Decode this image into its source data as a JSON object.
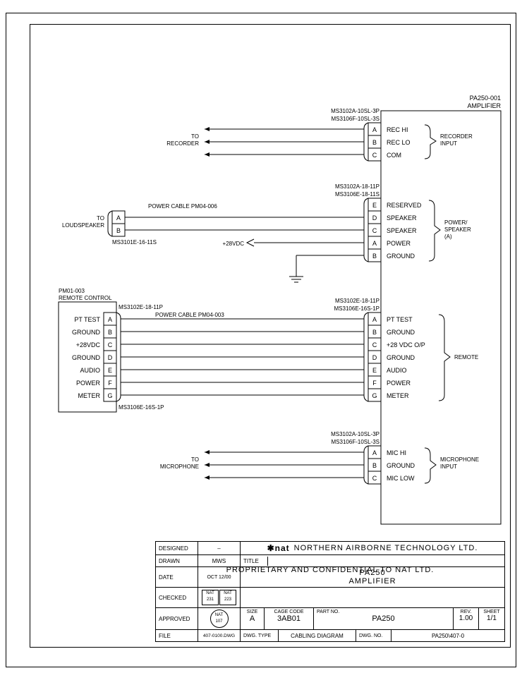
{
  "amplifier": {
    "title_top": "PA250-001",
    "title_sub": "AMPLIFIER",
    "connectors": {
      "recorder": {
        "top_part": "MS3102A-10SL-3P",
        "bottom_part": "MS3106F-10SL-3S",
        "pins": [
          {
            "pin": "A",
            "label": "REC HI"
          },
          {
            "pin": "B",
            "label": "REC LO"
          },
          {
            "pin": "C",
            "label": "COM"
          }
        ],
        "group": "RECORDER\nINPUT",
        "dest": "TO\nRECORDER"
      },
      "power_speaker": {
        "top_part": "MS3102A-18-11P",
        "bottom_part": "MS3106E-18-11S",
        "pins": [
          {
            "pin": "E",
            "label": "RESERVED"
          },
          {
            "pin": "D",
            "label": "SPEAKER"
          },
          {
            "pin": "C",
            "label": "SPEAKER"
          },
          {
            "pin": "A",
            "label": "POWER"
          },
          {
            "pin": "B",
            "label": "GROUND"
          }
        ],
        "group": "POWER/\nSPEAKER\n(A)",
        "cable": "POWER CABLE PM04-006",
        "v28": "+28VDC",
        "dest": "TO\nLOUDSPEAKER",
        "dest_conn": {
          "pins": [
            "A",
            "B"
          ],
          "part": "MS3101E-16-11S"
        }
      },
      "remote": {
        "top_part": "MS3102E-18-11P",
        "bottom_part": "MS3106E-16S-1P",
        "pins": [
          {
            "pin": "A",
            "label": "PT TEST"
          },
          {
            "pin": "B",
            "label": "GROUND"
          },
          {
            "pin": "C",
            "label": "+28 VDC O/P"
          },
          {
            "pin": "D",
            "label": "GROUND"
          },
          {
            "pin": "E",
            "label": "AUDIO"
          },
          {
            "pin": "F",
            "label": "POWER"
          },
          {
            "pin": "G",
            "label": "METER"
          }
        ],
        "group": "REMOTE",
        "cable": "POWER CABLE PM04-003"
      },
      "microphone": {
        "top_part": "MS3102A-10SL-3P",
        "bottom_part": "MS3106F-10SL-3S",
        "pins": [
          {
            "pin": "A",
            "label": "MIC HI"
          },
          {
            "pin": "B",
            "label": "GROUND"
          },
          {
            "pin": "C",
            "label": "MIC LOW"
          }
        ],
        "group": "MICROPHONE\nINPUT",
        "dest": "TO\nMICROPHONE"
      }
    }
  },
  "remote_control": {
    "title_top": "PM01-003",
    "title_sub": "REMOTE CONTROL",
    "top_part": "MS3102E-18-11P",
    "bottom_part": "MS3106E-16S-1P",
    "pins": [
      {
        "pin": "A",
        "label": "PT TEST"
      },
      {
        "pin": "B",
        "label": "GROUND"
      },
      {
        "pin": "C",
        "label": "+28VDC"
      },
      {
        "pin": "D",
        "label": "GROUND"
      },
      {
        "pin": "E",
        "label": "AUDIO"
      },
      {
        "pin": "F",
        "label": "POWER"
      },
      {
        "pin": "G",
        "label": "METER"
      }
    ]
  },
  "titleblock": {
    "proprietary": "PROPRIETARY AND CONFIDENTIAL TO NAT LTD.",
    "company_logo": "✱nat",
    "company": "NORTHERN AIRBORNE TECHNOLOGY LTD.",
    "designed_lbl": "DESIGNED",
    "designed": "–",
    "drawn_lbl": "DRAWN",
    "drawn": "MWS",
    "date_lbl": "DATE",
    "date": "OCT 12/00",
    "checked_lbl": "CHECKED",
    "checked_stamp1": "NAT\n231",
    "checked_stamp2": "NAT\n223",
    "approved_lbl": "APPROVED",
    "approved_stamp": "NAT\n107",
    "file_lbl": "FILE",
    "file": "407-0100.DWG",
    "title_lbl": "TITLE",
    "title1": "PA250",
    "title2": "AMPLIFIER",
    "size_lbl": "SIZE",
    "size": "A",
    "cage_lbl": "CAGE CODE",
    "cage": "3AB01",
    "part_lbl": "PART NO.",
    "part": "PA250",
    "rev_lbl": "REV.",
    "rev": "1.00",
    "sheet_lbl": "SHEET",
    "sheet": "1/1",
    "dwgtype_lbl": "DWG. TYPE",
    "dwgtype": "CABLING DIAGRAM",
    "dwgno_lbl": "DWG. NO.",
    "dwgno": "PA250\\407-0"
  }
}
